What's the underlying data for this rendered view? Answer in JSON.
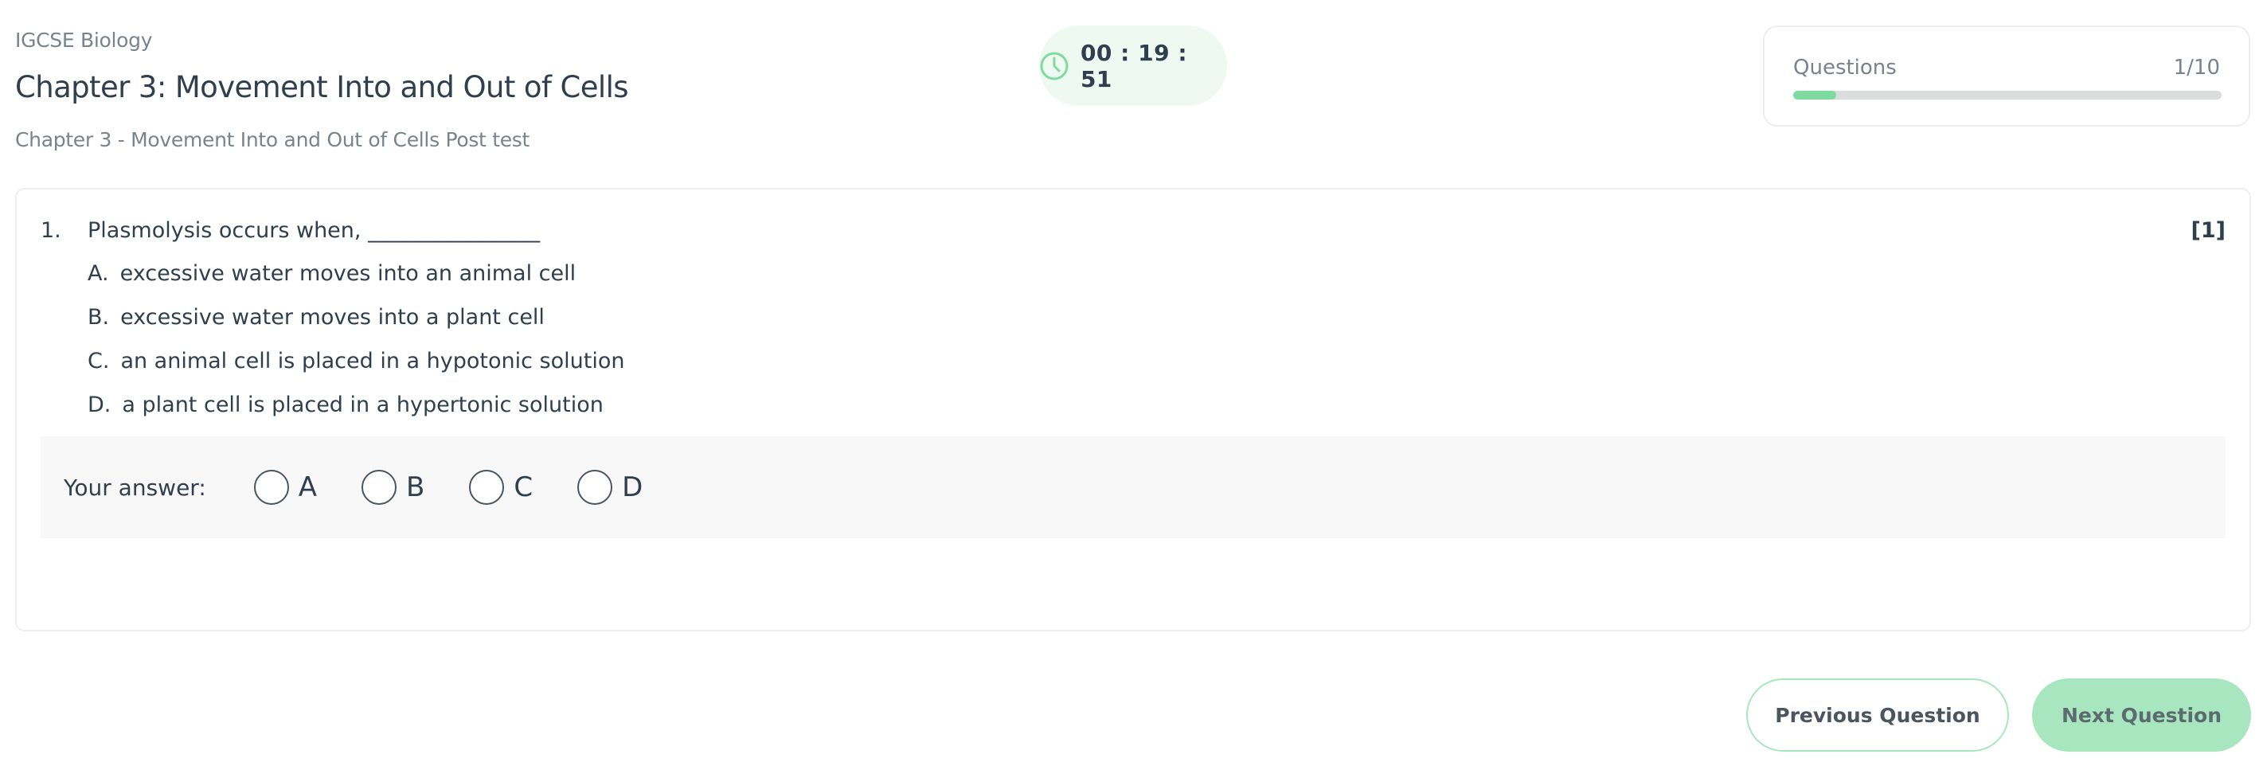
{
  "header": {
    "subject": "IGCSE Biology",
    "chapter_title": "Chapter 3: Movement Into and Out of Cells",
    "test_name": "Chapter 3 - Movement Into and Out of Cells Post test"
  },
  "timer": {
    "icon": "clock-icon",
    "time": "00 : 19 : 51",
    "accent": "#7edba0"
  },
  "progress": {
    "label": "Questions",
    "count": "1/10",
    "current": 1,
    "total": 10,
    "fill_color": "#7edba0"
  },
  "question": {
    "number": "1.",
    "text": "Plasmolysis occurs when, ________________",
    "marks": "[1]",
    "options": [
      {
        "letter": "A.",
        "text": "excessive water moves into an animal cell"
      },
      {
        "letter": "B.",
        "text": "excessive water moves into a plant cell"
      },
      {
        "letter": "C.",
        "text": "an animal cell is placed in a hypotonic solution"
      },
      {
        "letter": "D.",
        "text": "a plant cell is placed in a hypertonic solution"
      }
    ]
  },
  "answer": {
    "label": "Your answer:",
    "choices": [
      "A",
      "B",
      "C",
      "D"
    ]
  },
  "navigation": {
    "previous_label": "Previous Question",
    "next_label": "Next Question"
  }
}
